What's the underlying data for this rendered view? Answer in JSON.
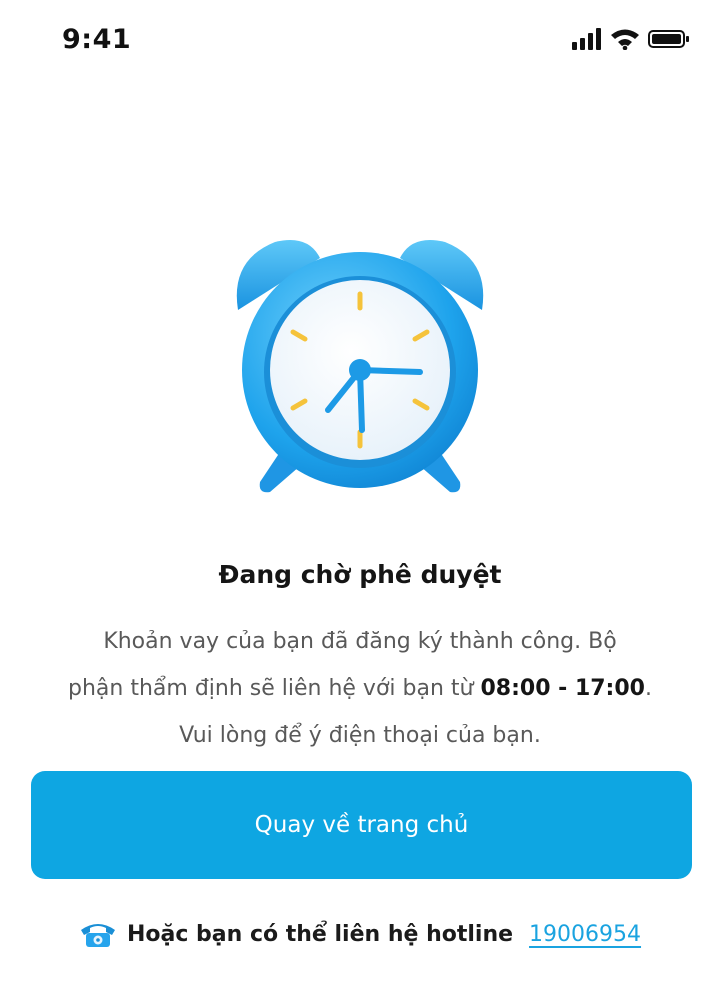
{
  "status_bar": {
    "time": "9:41",
    "icons": [
      "signal-icon",
      "wifi-icon",
      "battery-icon"
    ]
  },
  "illustration": {
    "icon": "alarm-clock-icon"
  },
  "title": "Đang chờ phê duyệt",
  "description": {
    "line1": "Khoản vay của bạn đã đăng ký thành công. Bộ",
    "line2_prefix": "phận thẩm định sẽ liên hệ với bạn từ ",
    "hours": "08:00 - 17:00",
    "line2_suffix": ".",
    "line3": "Vui lòng để ý điện thoại của bạn."
  },
  "home_button": {
    "label": "Quay về trang chủ"
  },
  "hotline": {
    "icon": "phone-icon",
    "text": "Hoặc bạn có thể liên hệ hotline",
    "number": "19006954"
  },
  "colors": {
    "accent": "#0ea6e2",
    "link": "#1aa3e0",
    "clock_face": "#f2f8fd",
    "tick": "#f5c33b"
  }
}
